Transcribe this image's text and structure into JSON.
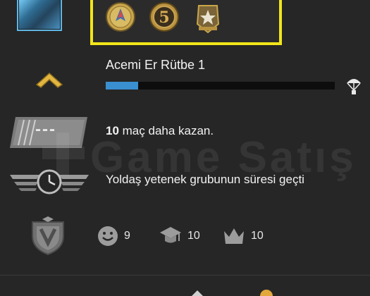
{
  "profile": {
    "rank_title": "Acemi Er Rütbe 1",
    "rank_progress": 0.14,
    "wins_count": "10",
    "wins_text": " maç daha kazan.",
    "cooldown_text": "Yoldaş yetenek grubunun süresi geçti",
    "gun_placeholder": "---"
  },
  "watermark": {
    "text": "Game Satış"
  },
  "stats": {
    "friendly": "9",
    "teacher": "10",
    "leader": "10"
  },
  "icons": {
    "avatar": "player-avatar",
    "medal_1": "service-medal-icon",
    "medal_2": "five-year-coin-icon",
    "medal_3": "star-badge-icon",
    "rank": "chevron-rank-icon",
    "drop": "parachute-icon",
    "weapon": "gun-icon",
    "cooldown": "wings-clock-icon",
    "shield": "shield-emblem-icon",
    "friendly": "smiley-icon",
    "teacher": "graduation-cap-icon",
    "leader": "crown-icon"
  },
  "colors": {
    "background": "#262626",
    "highlight": "#f2e51a",
    "progress": "#3a8fd0",
    "gold": "#c9a64a"
  }
}
